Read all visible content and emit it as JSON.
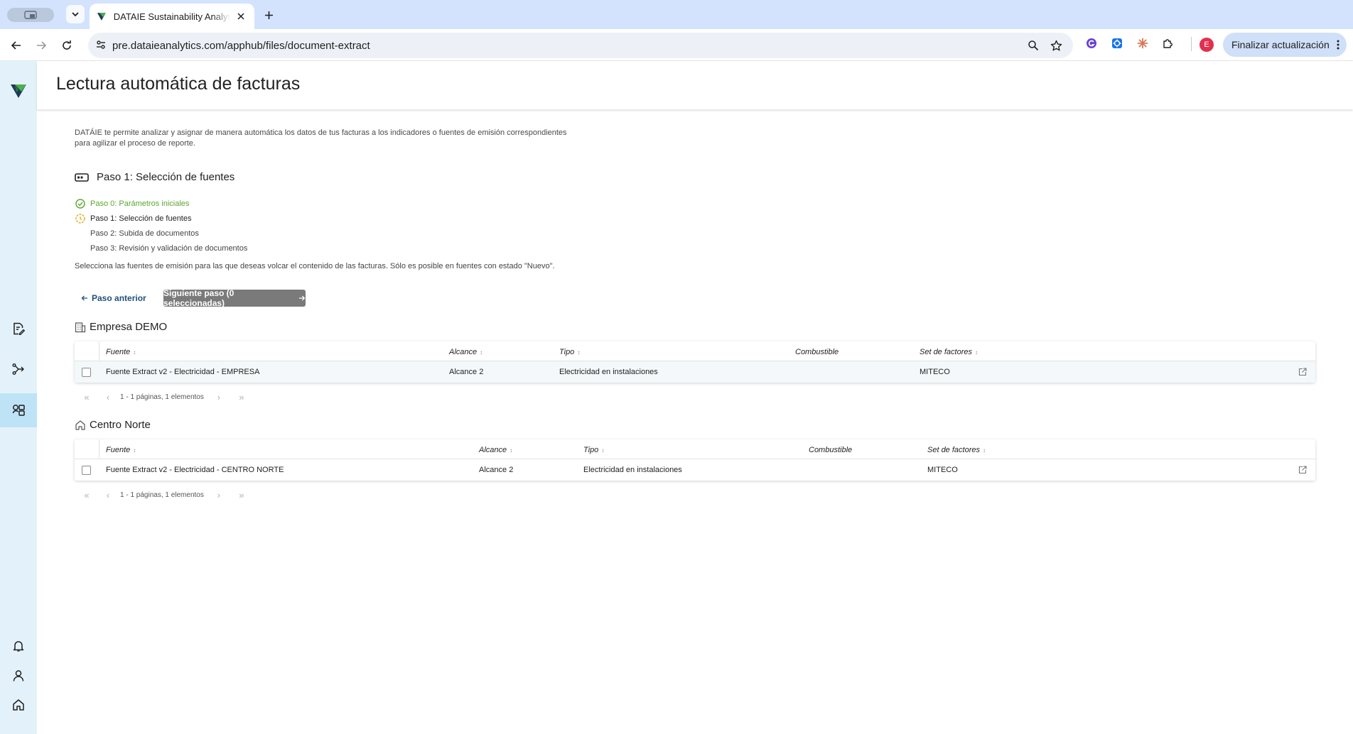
{
  "browser": {
    "tab_title": "DATAIE Sustainability Analytics",
    "url": "pre.dataieanalytics.com/apphub/files/document-extract",
    "update_button": "Finalizar actualización",
    "profile_initial": "E"
  },
  "page": {
    "title": "Lectura automática de facturas",
    "intro": "DATÁIE te permite analizar y asignar de manera automática los datos de tus facturas a los indicadores o fuentes de emisión correspondientes para agilizar el proceso de reporte.",
    "step_heading": "Paso 1: Selección de fuentes",
    "steps": [
      {
        "label": "Paso 0: Parámetros iniciales",
        "status": "done"
      },
      {
        "label": "Paso 1: Selección de fuentes",
        "status": "current"
      },
      {
        "label": "Paso 2: Subida de documentos",
        "status": "pending"
      },
      {
        "label": "Paso 3: Revisión y validación de documentos",
        "status": "pending"
      }
    ],
    "instructions": "Selecciona las fuentes de emisión para las que deseas volcar el contenido de las facturas. Sólo es posible en fuentes con estado \"Nuevo\".",
    "prev_button": "Paso anterior",
    "next_button": "Siguiente paso (0 seleccionadas)"
  },
  "columns": {
    "fuente": "Fuente",
    "alcance": "Alcance",
    "tipo": "Tipo",
    "combustible": "Combustible",
    "set_factores": "Set de factores"
  },
  "groups": [
    {
      "name": "Empresa DEMO",
      "icon": "building-icon",
      "row": {
        "fuente": "Fuente Extract v2 - Electricidad - EMPRESA",
        "alcance": "Alcance 2",
        "tipo": "Electricidad en instalaciones",
        "combustible": "",
        "set_factores": "MITECO"
      },
      "pagination": "1 -  1 páginas, 1 elementos"
    },
    {
      "name": "Centro Norte",
      "icon": "home-icon",
      "row": {
        "fuente": "Fuente Extract v2 - Electricidad - CENTRO NORTE",
        "alcance": "Alcance 2",
        "tipo": "Electricidad en instalaciones",
        "combustible": "",
        "set_factores": "MITECO"
      },
      "pagination": "1 -  1 páginas, 1 elementos"
    }
  ],
  "colors": {
    "accent_done": "#5aa72d",
    "accent_current": "#e6a817",
    "rail_bg": "#e3f2fa",
    "rail_active": "#bfe3f6",
    "link": "#1f4f7a"
  }
}
